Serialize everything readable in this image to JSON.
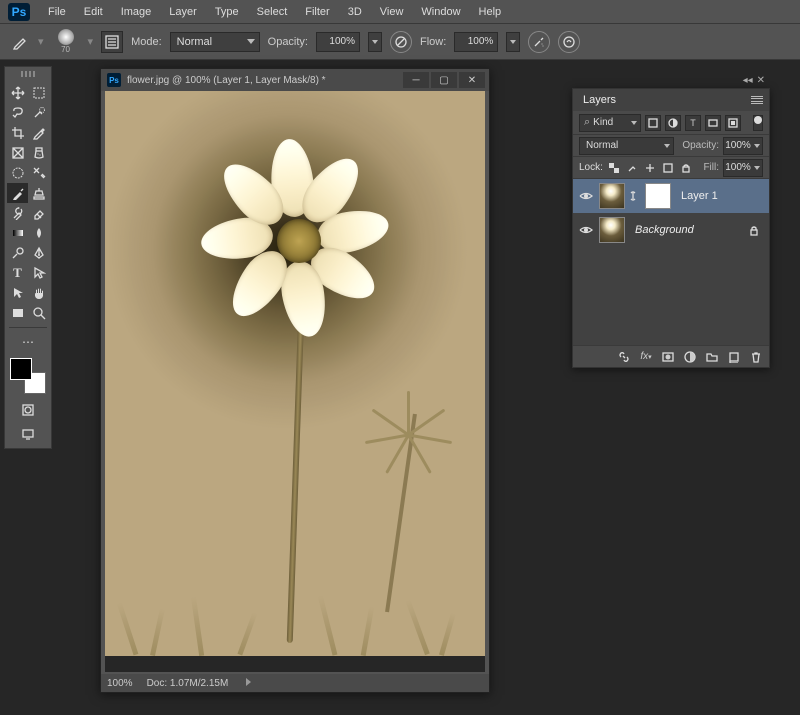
{
  "app": {
    "logo": "Ps"
  },
  "menu": {
    "items": [
      "File",
      "Edit",
      "Image",
      "Layer",
      "Type",
      "Select",
      "Filter",
      "3D",
      "View",
      "Window",
      "Help"
    ]
  },
  "options": {
    "brush_size": "70",
    "mode_label": "Mode:",
    "mode_value": "Normal",
    "opacity_label": "Opacity:",
    "opacity_value": "100%",
    "flow_label": "Flow:",
    "flow_value": "100%"
  },
  "document": {
    "title": "flower.jpg @ 100% (Layer 1, Layer Mask/8) *",
    "zoom": "100%",
    "doc_info": "Doc: 1.07M/2.15M"
  },
  "layers_panel": {
    "title": "Layers",
    "filter_kind": "Kind",
    "blend_mode": "Normal",
    "opacity_label": "Opacity:",
    "opacity_value": "100%",
    "lock_label": "Lock:",
    "fill_label": "Fill:",
    "fill_value": "100%",
    "layers": [
      {
        "name": "Layer 1",
        "selected": true,
        "has_mask": true,
        "locked": false
      },
      {
        "name": "Background",
        "selected": false,
        "has_mask": false,
        "locked": true
      }
    ]
  }
}
